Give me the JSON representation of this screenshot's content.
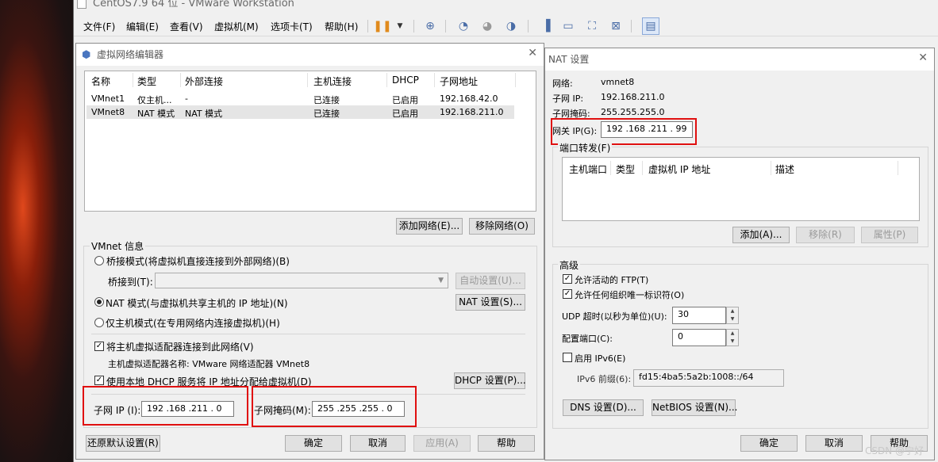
{
  "window": {
    "title": "CentOS7.9 64 位 - VMware Workstation"
  },
  "menu": [
    "文件(F)",
    "编辑(E)",
    "查看(V)",
    "虚拟机(M)",
    "选项卡(T)",
    "帮助(H)"
  ],
  "vne": {
    "title": "虚拟网络编辑器",
    "columns": [
      "名称",
      "类型",
      "外部连接",
      "主机连接",
      "DHCP",
      "子网地址"
    ],
    "rows": [
      [
        "VMnet1",
        "仅主机...",
        "-",
        "已连接",
        "已启用",
        "192.168.42.0"
      ],
      [
        "VMnet8",
        "NAT 模式",
        "NAT 模式",
        "已连接",
        "已启用",
        "192.168.211.0"
      ]
    ],
    "add_network": "添加网络(E)...",
    "remove_network": "移除网络(O)",
    "info_title": "VMnet 信息",
    "bridge_mode": "桥接模式(将虚拟机直接连接到外部网络)(B)",
    "bridge_to": "桥接到(T):",
    "auto_settings": "自动设置(U)...",
    "nat_mode": "NAT 模式(与虚拟机共享主机的 IP 地址)(N)",
    "nat_settings": "NAT 设置(S)...",
    "host_only": "仅主机模式(在专用网络内连接虚拟机)(H)",
    "connect_adapter": "将主机虚拟适配器连接到此网络(V)",
    "adapter_name": "主机虚拟适配器名称: VMware 网络适配器 VMnet8",
    "use_dhcp": "使用本地 DHCP 服务将 IP 地址分配给虚拟机(D)",
    "dhcp_settings": "DHCP 设置(P)...",
    "subnet_ip_label": "子网 IP (I):",
    "subnet_ip": "192 .168 .211 . 0",
    "subnet_mask_label": "子网掩码(M):",
    "subnet_mask": "255 .255 .255 . 0",
    "restore": "还原默认设置(R)",
    "ok": "确定",
    "cancel": "取消",
    "apply": "应用(A)",
    "help": "帮助"
  },
  "nat": {
    "title": "NAT 设置",
    "network_label": "网络:",
    "network": "vmnet8",
    "subnet_ip_label": "子网 IP:",
    "subnet_ip": "192.168.211.0",
    "subnet_mask_label": "子网掩码:",
    "subnet_mask": "255.255.255.0",
    "gateway_label": "网关 IP(G):",
    "gateway": "192 .168 .211 . 99",
    "port_forwarding": "端口转发(F)",
    "pf_columns": [
      "主机端口",
      "类型",
      "虚拟机 IP 地址",
      "描述"
    ],
    "add": "添加(A)...",
    "remove": "移除(R)",
    "properties": "属性(P)",
    "advanced": "高级",
    "allow_ftp": "允许活动的 FTP(T)",
    "allow_oui": "允许任何组织唯一标识符(O)",
    "udp_label": "UDP 超时(以秒为单位)(U):",
    "udp": "30",
    "config_port_label": "配置端口(C):",
    "config_port": "0",
    "ipv6": "启用 IPv6(E)",
    "ipv6_prefix_label": "IPv6 前缀(6):",
    "ipv6_prefix": "fd15:4ba5:5a2b:1008::/64",
    "dns": "DNS 设置(D)...",
    "netbios": "NetBIOS 设置(N)...",
    "ok": "确定",
    "cancel": "取消",
    "help": "帮助"
  },
  "watermark": "CSDN @宁好",
  "colors": {
    "highlight": "#e01010",
    "accent": "#4a6da7"
  }
}
